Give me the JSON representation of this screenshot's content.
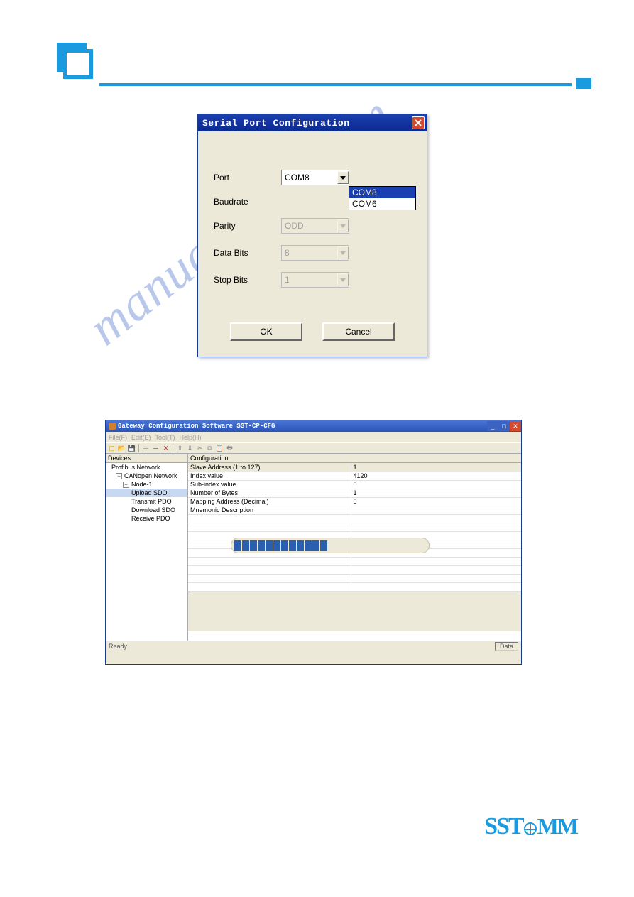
{
  "watermark_text": "manualshive.com",
  "dialog1": {
    "title": "Serial Port Configuration",
    "fields": {
      "port_label": "Port",
      "port_value": "COM8",
      "baudrate_label": "Baudrate",
      "parity_label": "Parity",
      "parity_value": "ODD",
      "databits_label": "Data Bits",
      "databits_value": "8",
      "stopbits_label": "Stop Bits",
      "stopbits_value": "1"
    },
    "dropdown_options": [
      "COM8",
      "COM6"
    ],
    "buttons": {
      "ok": "OK",
      "cancel": "Cancel"
    }
  },
  "dialog2": {
    "title": "Gateway Configuration Software SST-CP-CFG",
    "menu": [
      "File(F)",
      "Edit(E)",
      "Tool(T)",
      "Help(H)"
    ],
    "tree_header": "Devices",
    "tree": {
      "root1": "Profibus Network",
      "root2": "CANopen Network",
      "node1": "Node-1",
      "up_sdo": "Upload SDO",
      "tx_pdo": "Transmit PDO",
      "dl_sdo": "Download SDO",
      "rx_pdo": "Receive PDO"
    },
    "grid_header": "Configuration",
    "grid": [
      {
        "k": "Slave Address (1 to 127)",
        "v": "1"
      },
      {
        "k": "Index value",
        "v": "4120"
      },
      {
        "k": "Sub-index value",
        "v": "0"
      },
      {
        "k": "Number of Bytes",
        "v": "1"
      },
      {
        "k": "Mapping Address (Decimal)",
        "v": "0"
      },
      {
        "k": "Mnemonic Description",
        "v": ""
      }
    ],
    "status_left": "Ready",
    "status_right": "Data"
  },
  "footer_logo_text": "SST"
}
